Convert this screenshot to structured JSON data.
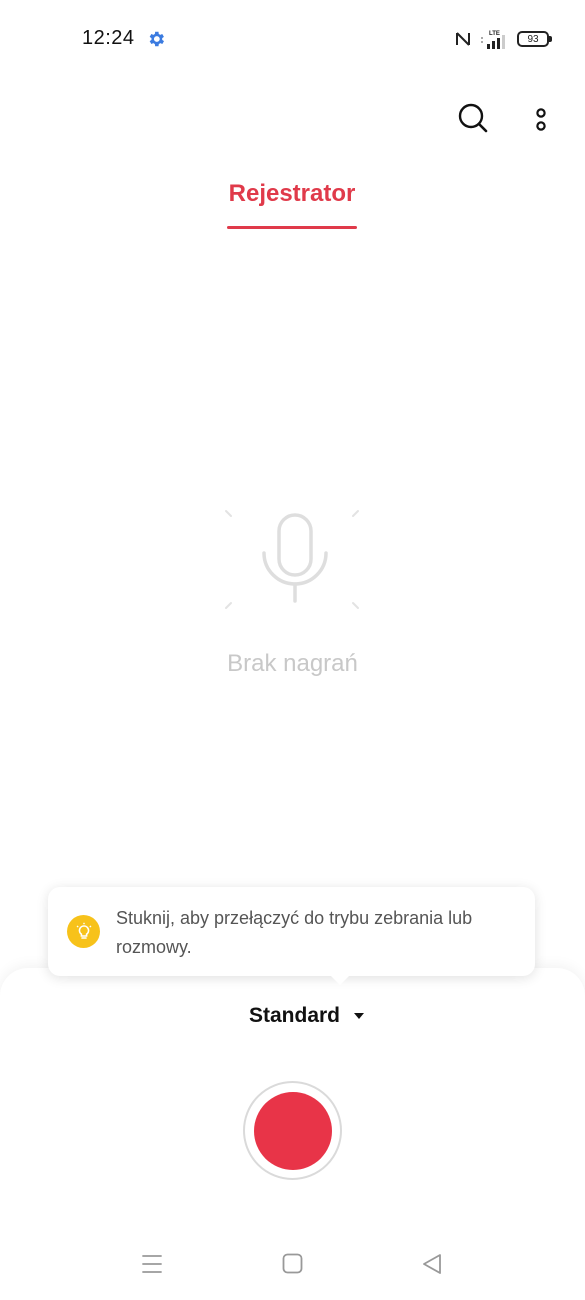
{
  "status_bar": {
    "time": "12:24",
    "battery": "93",
    "icons": [
      "gear-icon",
      "nfc-icon",
      "lte-signal-icon",
      "battery-icon"
    ],
    "network": "LTE"
  },
  "toolbar": {
    "icons": [
      "search-icon",
      "more-vertical-icon"
    ]
  },
  "tabs": [
    {
      "label": "Rejestrator",
      "active": true
    }
  ],
  "empty_state": {
    "icon": "microphone-icon",
    "message": "Brak nagrań"
  },
  "tooltip": {
    "icon": "lightbulb-icon",
    "text": "Stuknij, aby przełączyć do trybu zebrania lub rozmowy."
  },
  "recorder": {
    "mode_label": "Standard",
    "record_button": "record-icon"
  },
  "navigation_bar": {
    "icons": [
      "menu-icon",
      "home-icon",
      "back-icon"
    ]
  },
  "colors": {
    "accent": "#e03a4a",
    "record": "#e83448",
    "tip_icon": "#f7c21a",
    "settings_icon": "#3b7be0"
  }
}
